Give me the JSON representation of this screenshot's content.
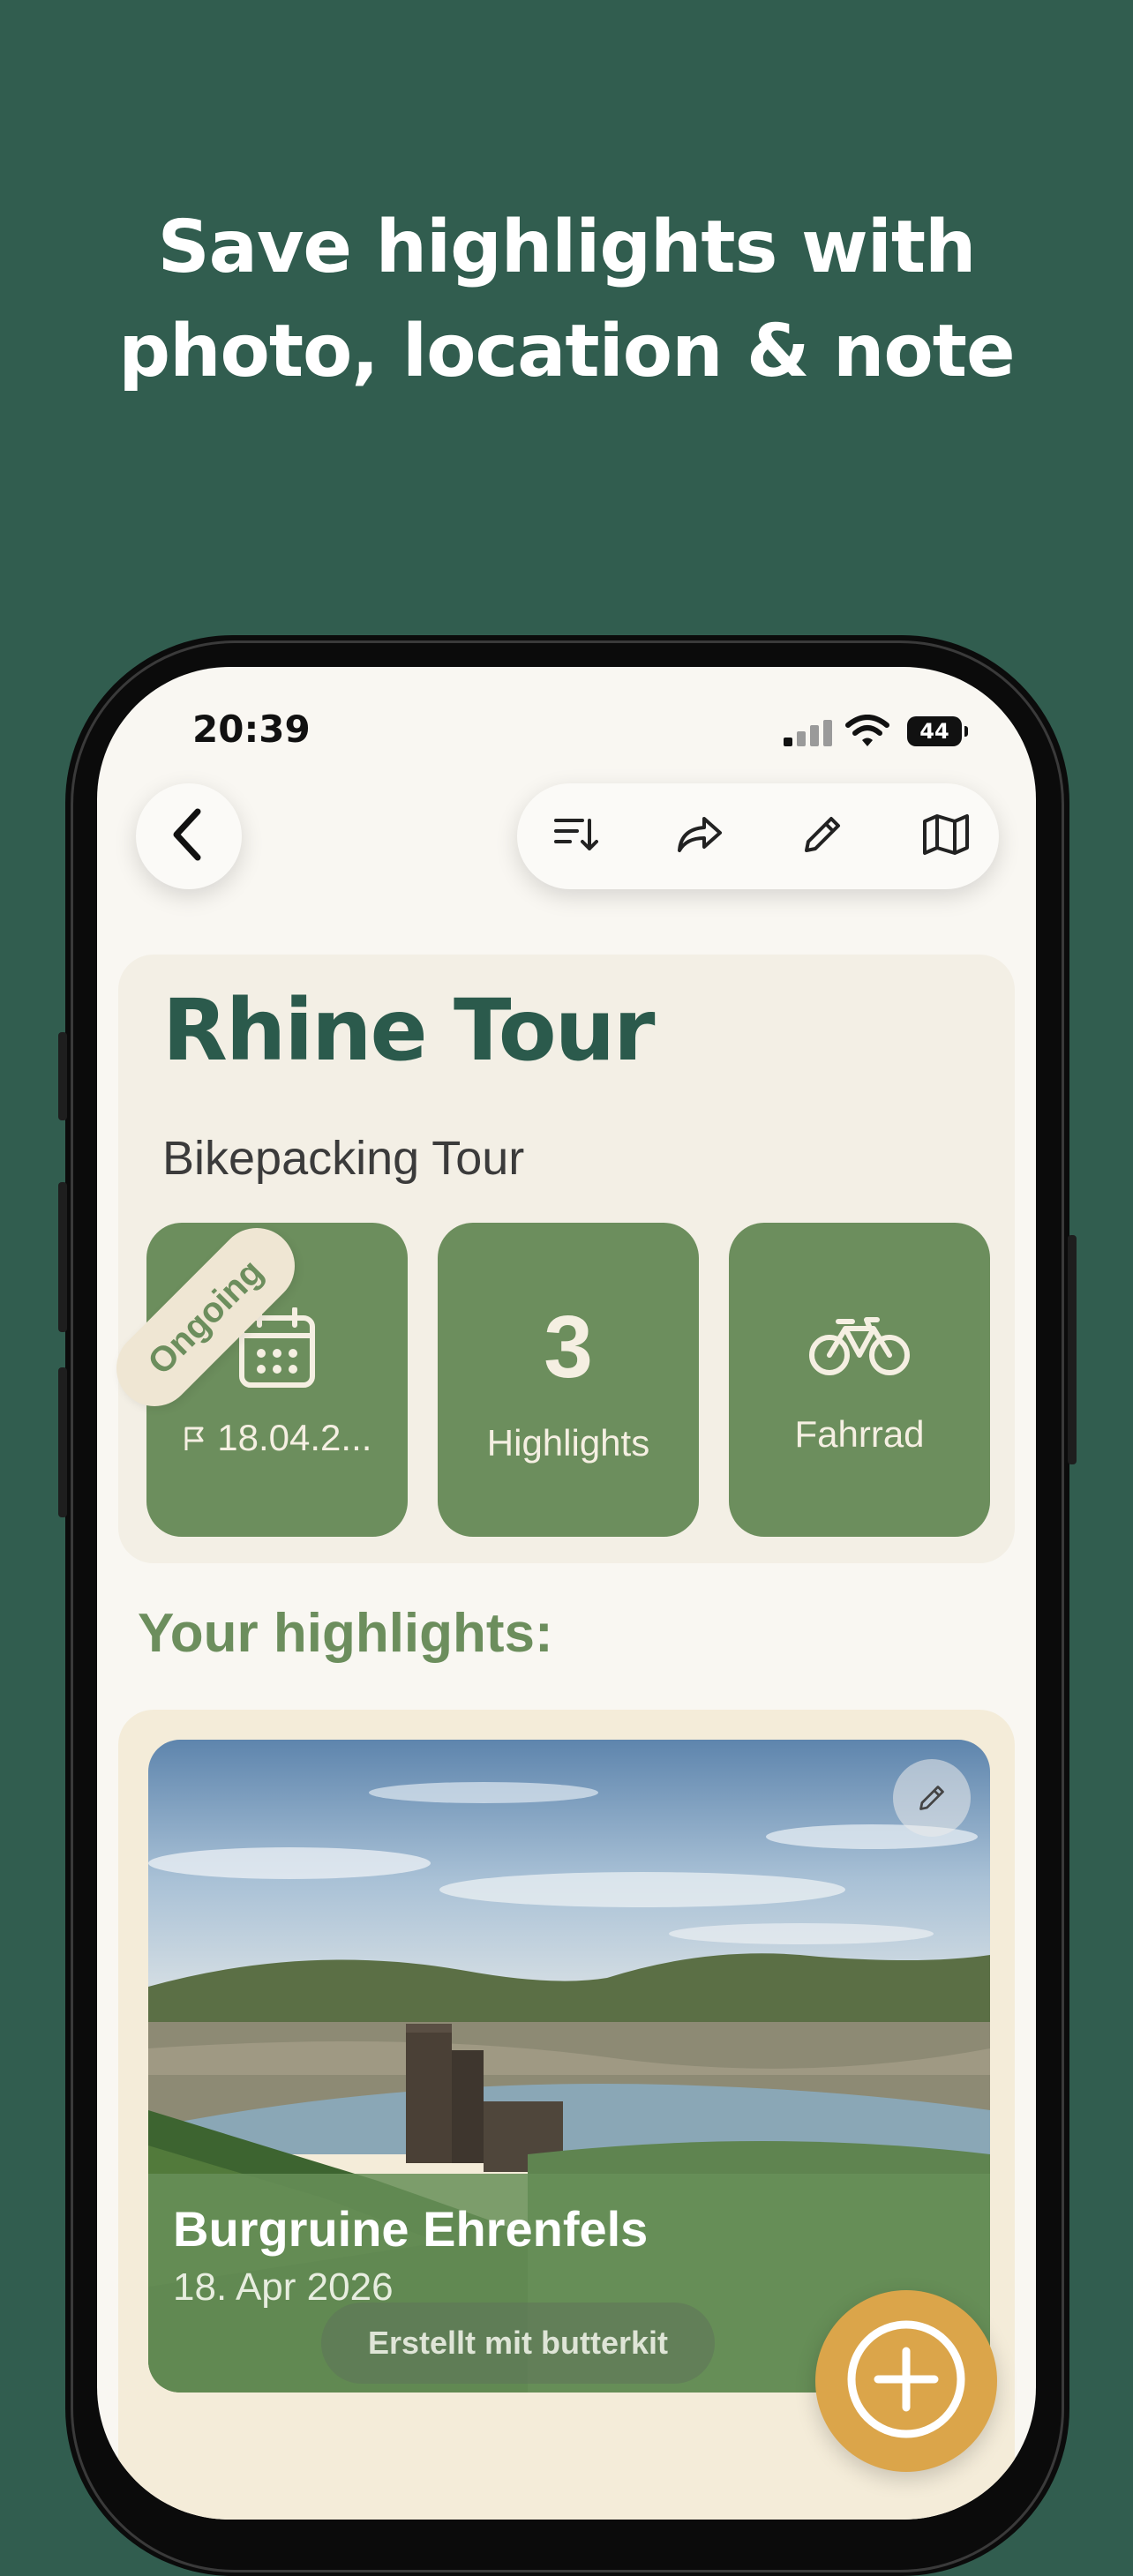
{
  "marketing": {
    "headline_line1": "Save highlights with",
    "headline_line2": "photo, location & note"
  },
  "status_bar": {
    "time": "20:39",
    "battery": "44",
    "icons": [
      "signal-icon",
      "wifi-icon",
      "battery-icon"
    ]
  },
  "nav": {
    "back_icon": "chevron-left-icon",
    "actions": [
      "sort-icon",
      "share-icon",
      "pencil-icon",
      "map-icon"
    ]
  },
  "tour": {
    "title": "Rhine Tour",
    "subtitle": "Bikepacking Tour",
    "badge": "Ongoing",
    "start_date": "18.04.2...",
    "highlight_count": "3",
    "highlight_label": "Highlights",
    "transport_label": "Fahrrad"
  },
  "highlights_section": {
    "title": "Your highlights:",
    "items": [
      {
        "title": "Burgruine Ehrenfels",
        "date": "18. Apr 2026"
      }
    ]
  },
  "footer": {
    "credit": "Erstellt mit butterkit"
  },
  "colors": {
    "background": "#315d4f",
    "brand_dark_green": "#2b5a4c",
    "card_green": "#6c8e5d",
    "fab_gold": "#dba54a"
  }
}
